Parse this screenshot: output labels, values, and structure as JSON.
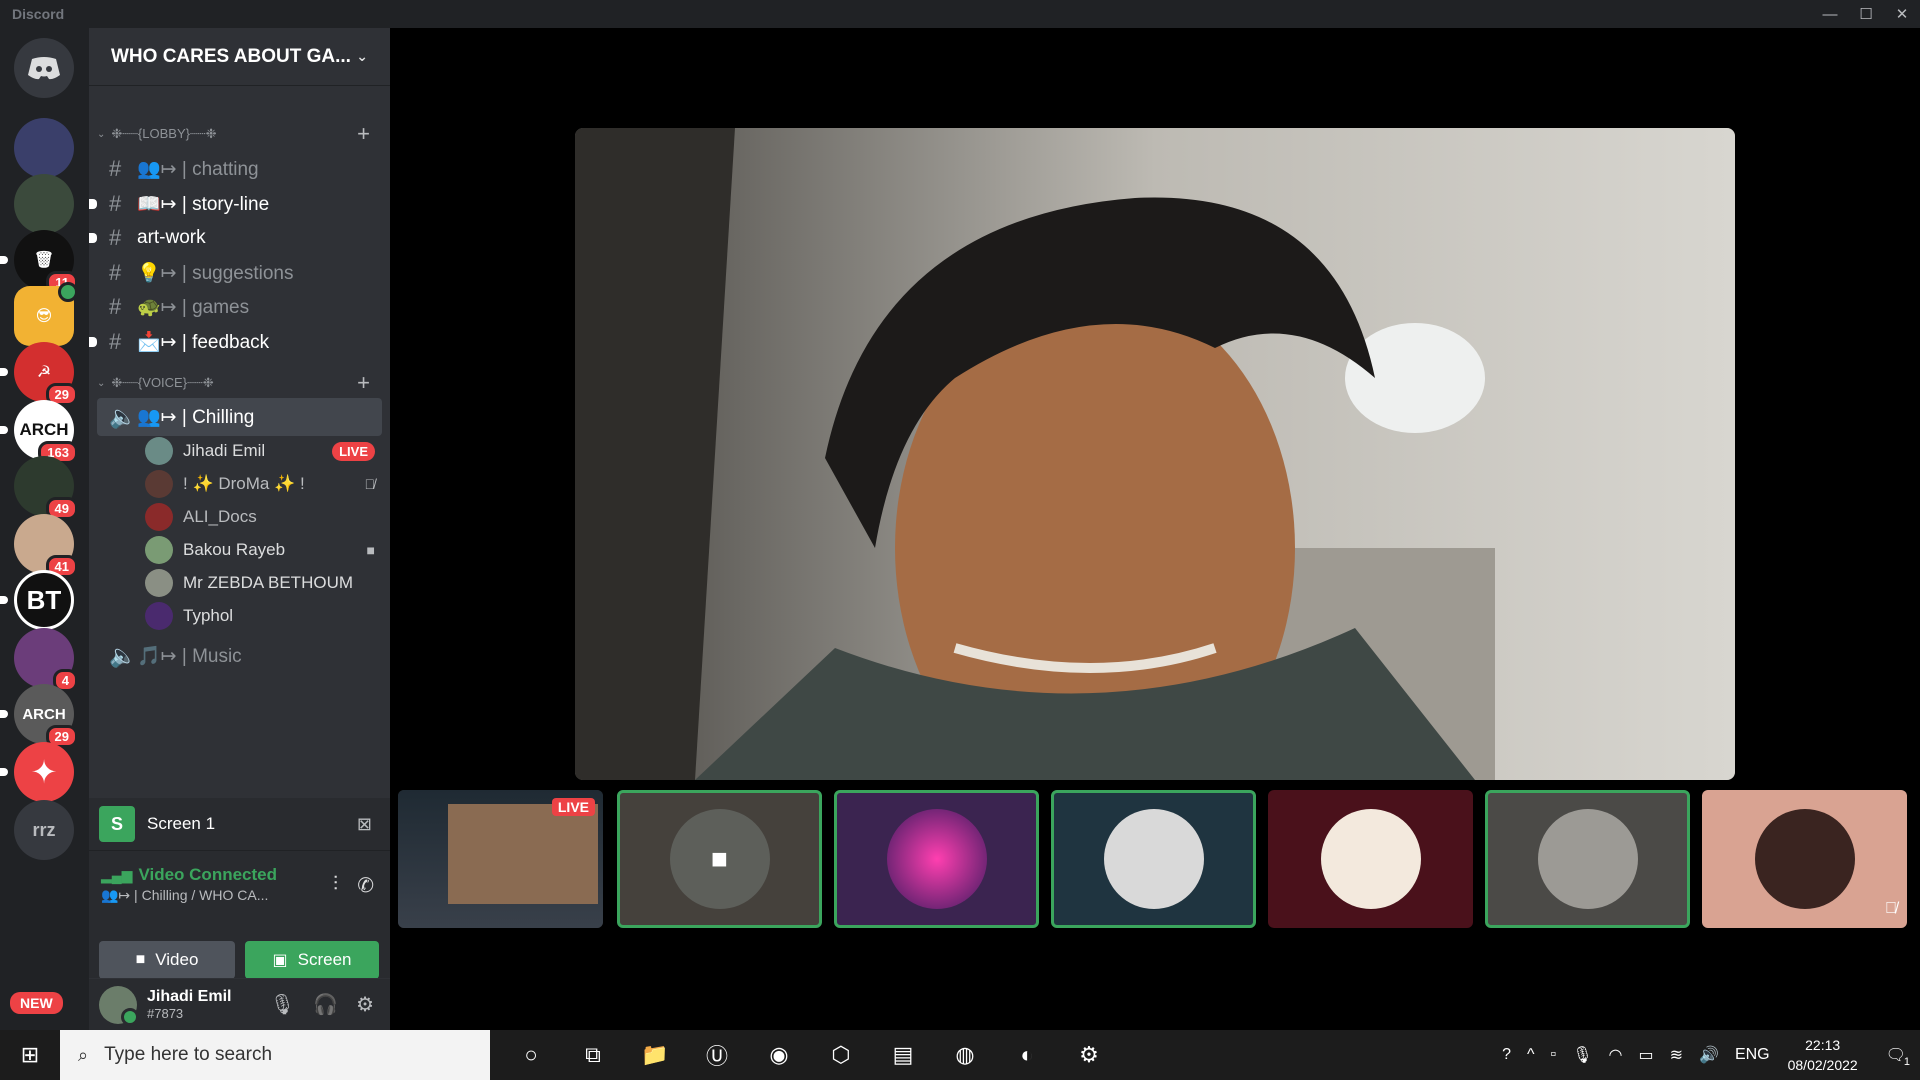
{
  "window": {
    "title": "Discord",
    "minimize": "—",
    "maximize": "☐",
    "close": "✕"
  },
  "guild": {
    "name": "WHO CARES ABOUT GA...",
    "chevron": "⌄"
  },
  "server_rail": {
    "badges": [
      "11",
      "29",
      "163",
      "49",
      "41",
      "4",
      "29"
    ],
    "labels": {
      "bt": "BT",
      "arch": "ARCH",
      "arch2": "ARCH",
      "rrz": "rrz"
    },
    "new_label": "NEW"
  },
  "categories": {
    "lobby": "❉┈┈{LOBBY}┈┈❉",
    "voice": "❉┈┈{VOICE}┈┈❉"
  },
  "channels": [
    {
      "name": "👥↦ | chatting",
      "icon": "hash"
    },
    {
      "name": "📖↦ | story-line",
      "icon": "hash"
    },
    {
      "name": "art-work",
      "icon": "hash"
    },
    {
      "name": "💡↦ | suggestions",
      "icon": "hash"
    },
    {
      "name": "🐢↦ | games",
      "icon": "hash"
    },
    {
      "name": "📩↦ | feedback",
      "icon": "hash"
    }
  ],
  "voice_channels": [
    {
      "name": "👥↦ | Chilling"
    },
    {
      "name": "🎵↦ | Music"
    }
  ],
  "voice_users": [
    {
      "name": "Jihadi Emil",
      "status": "LIVE"
    },
    {
      "name": "! ✨ DroMa ✨ !",
      "status": "muted"
    },
    {
      "name": "ALI_Docs",
      "status": ""
    },
    {
      "name": "Bakou Rayeb",
      "status": "video"
    },
    {
      "name": "Mr ZEBDA BETHOUM",
      "status": ""
    },
    {
      "name": "Typhol",
      "status": ""
    }
  ],
  "stream_panel": {
    "icon_letter": "S",
    "title": "Screen 1"
  },
  "rtc": {
    "status": "Video Connected",
    "channel": "👥↦ | Chilling / WHO CA...",
    "video_label": "Video",
    "screen_label": "Screen"
  },
  "user": {
    "name": "Jihadi Emil",
    "tag": "#7873"
  },
  "tiles": {
    "live_label": "LIVE"
  },
  "colors": {
    "green": "#3ba55d",
    "red": "#ed4245",
    "sidebar": "#2f3136",
    "rail": "#202225"
  },
  "taskbar": {
    "search_placeholder": "Type here to search",
    "lang": "ENG",
    "time": "22:13",
    "date": "08/02/2022",
    "notif_count": "1"
  }
}
